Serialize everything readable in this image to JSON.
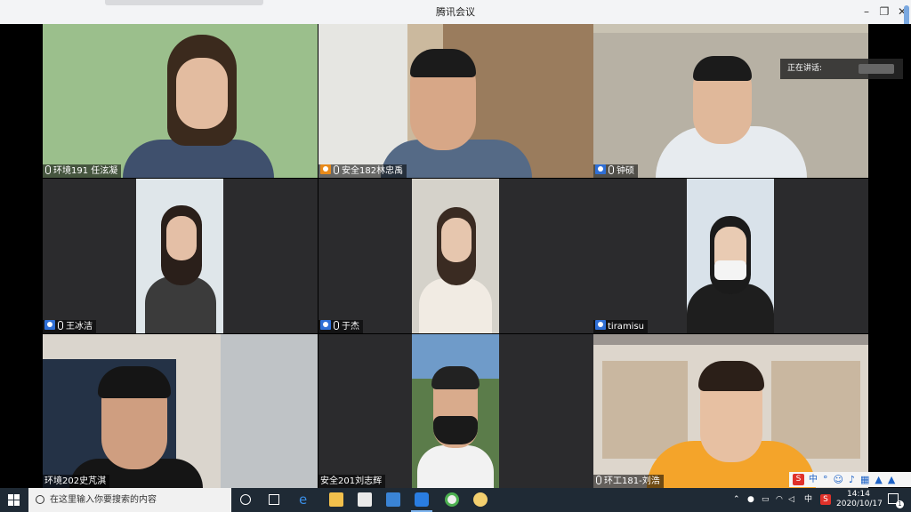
{
  "window": {
    "title": "腾讯会议",
    "min_label": "–",
    "restore_label": "❐",
    "close_label": "✕"
  },
  "speaking_label": "正在讲话:",
  "participants": [
    {
      "name": "环境191 任泫凝",
      "cam_icon": false
    },
    {
      "name": "安全182林忠禹",
      "cam_icon": true,
      "cam_color": "#e88a1a"
    },
    {
      "name": "钟硕",
      "cam_icon": true
    },
    {
      "name": "王冰洁",
      "cam_icon": true
    },
    {
      "name": "于杰",
      "cam_icon": true
    },
    {
      "name": "tiramisu",
      "cam_icon": true
    },
    {
      "name": "环境202史芃淇",
      "cam_icon": false
    },
    {
      "name": "安全201刘志辉",
      "cam_icon": false
    },
    {
      "name": "环工181-刘浩",
      "cam_icon": false
    }
  ],
  "taskbar": {
    "search_placeholder": "在这里输入你要搜索的内容",
    "time": "14:14",
    "date": "2020/10/17",
    "ime_label": "中",
    "lang_label": "中",
    "notify_count": "1"
  }
}
